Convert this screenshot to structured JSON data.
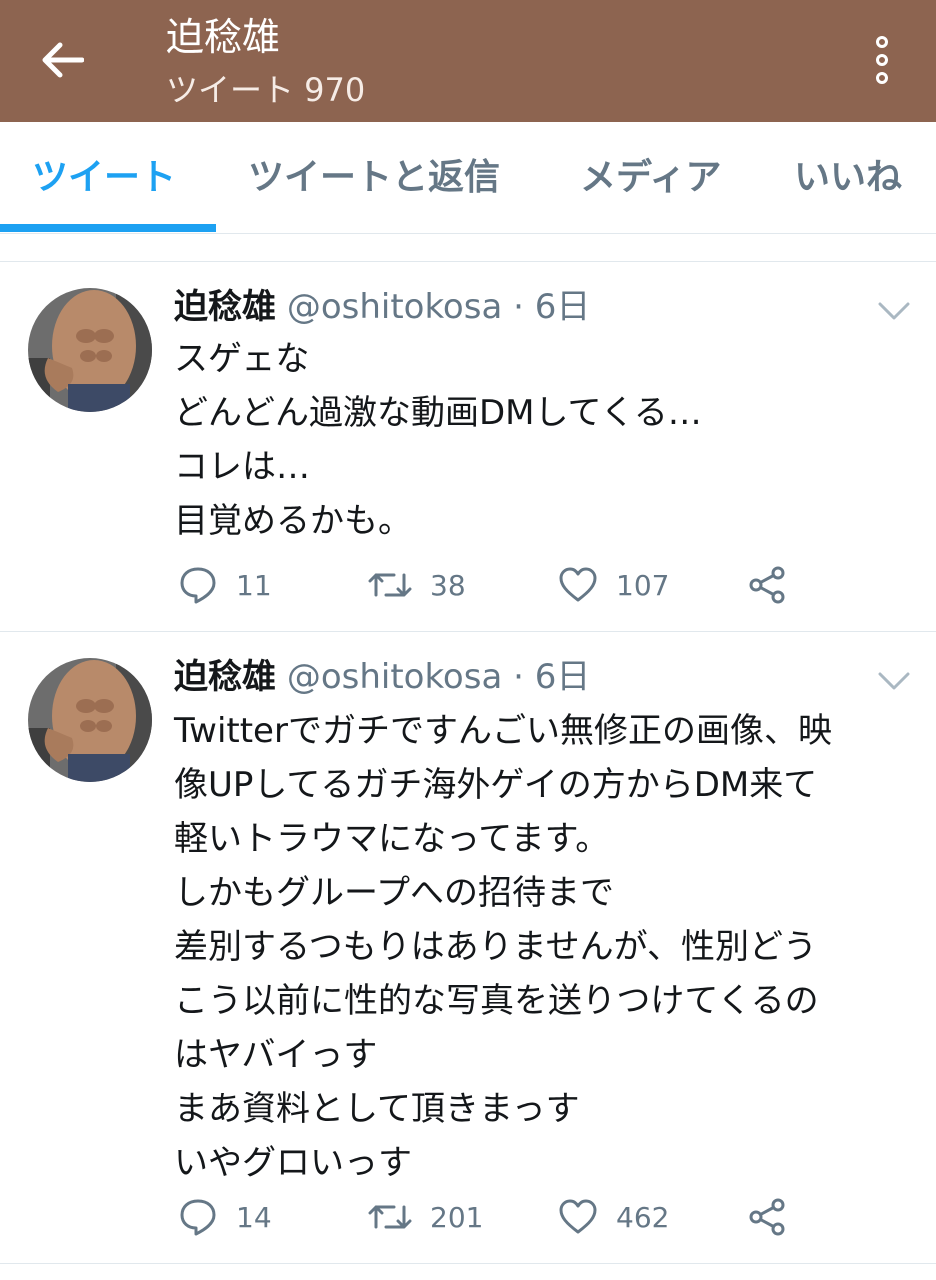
{
  "header": {
    "title": "迫稔雄",
    "tweet_count": "ツイート 970"
  },
  "tabs": [
    {
      "label": "ツイート",
      "active": true
    },
    {
      "label": "ツイートと返信",
      "active": false
    },
    {
      "label": "メディア",
      "active": false
    },
    {
      "label": "いいね",
      "active": false
    }
  ],
  "colors": {
    "header_bg": "#8d6450",
    "accent": "#1da1f2",
    "muted": "#657786"
  },
  "tweets": [
    {
      "name": "迫稔雄",
      "meta": "@oshitokosa · 6日",
      "lines": [
        "スゲェな",
        "どんどん過激な動画DMしてくる…",
        "コレは…",
        "目覚めるかも。"
      ],
      "replies": "11",
      "retweets": "38",
      "likes": "107"
    },
    {
      "name": "迫稔雄",
      "meta": "@oshitokosa · 6日",
      "lines": [
        "Twitterでガチですんごい無修正の画像、映",
        "像UPしてるガチ海外ゲイの方からDM来て",
        "軽いトラウマになってます。",
        "しかもグループへの招待まで",
        "差別するつもりはありませんが、性別どう",
        "こう以前に性的な写真を送りつけてくるの",
        "はヤバイっす",
        "まあ資料として頂きまっす",
        "いやグロいっす"
      ],
      "replies": "14",
      "retweets": "201",
      "likes": "462"
    }
  ],
  "icons": {
    "back": "arrow-left-icon",
    "more": "vertical-dots-icon",
    "caret": "chevron-down-icon",
    "reply": "speech-bubble-icon",
    "retweet": "retweet-icon",
    "like": "heart-icon",
    "share": "share-icon"
  }
}
